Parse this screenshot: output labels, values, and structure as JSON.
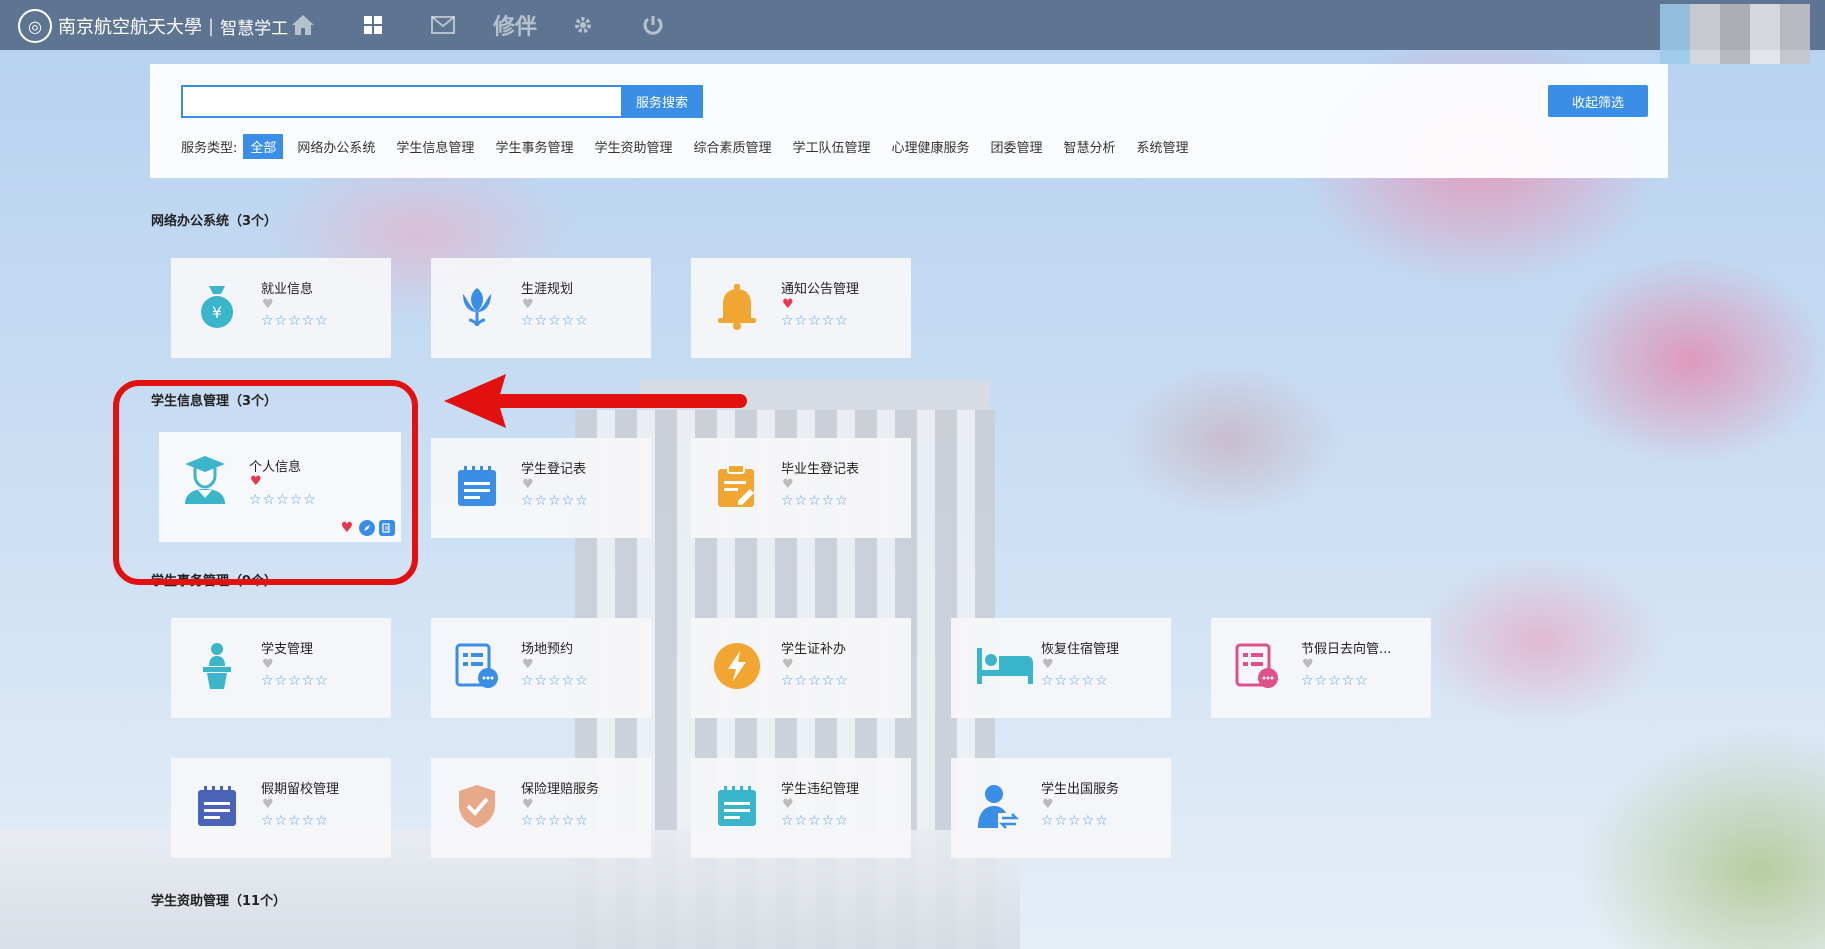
{
  "header": {
    "school_name": "南京航空航天大學",
    "separator": "|",
    "system_name": "智慧学工",
    "nav_text": "修伴",
    "seal_glyph": "◎"
  },
  "search": {
    "value": "",
    "placeholder": "",
    "button_label": "服务搜索",
    "collapse_label": "收起筛选"
  },
  "filters": {
    "label": "服务类型:",
    "chips": [
      "全部",
      "网络办公系统",
      "学生信息管理",
      "学生事务管理",
      "学生资助管理",
      "综合素质管理",
      "学工队伍管理",
      "心理健康服务",
      "团委管理",
      "智慧分析",
      "系统管理"
    ],
    "active": "全部"
  },
  "sections": {
    "office": {
      "title": "网络办公系统（3个）",
      "cards": [
        {
          "title": "就业信息",
          "favorited": false,
          "icon": "money-bag-icon",
          "color": "#3bb5c9"
        },
        {
          "title": "生涯规划",
          "favorited": false,
          "icon": "tulip-icon",
          "color": "#3a8ee6"
        },
        {
          "title": "通知公告管理",
          "favorited": true,
          "icon": "bell-icon",
          "color": "#f0a630"
        }
      ]
    },
    "info": {
      "title": "学生信息管理（3个）",
      "cards": [
        {
          "title": "个人信息",
          "favorited": true,
          "icon": "graduate-avatar-icon",
          "color": "#3bb5c9"
        },
        {
          "title": "学生登记表",
          "favorited": false,
          "icon": "calendar-list-icon",
          "color": "#3a8ee6"
        },
        {
          "title": "毕业生登记表",
          "favorited": false,
          "icon": "clipboard-edit-icon",
          "color": "#f0a630"
        }
      ]
    },
    "affairs": {
      "title": "学生事务管理（9个）",
      "cards": [
        {
          "title": "学支管理",
          "favorited": false,
          "icon": "podium-person-icon",
          "color": "#3bb5c9"
        },
        {
          "title": "场地预约",
          "favorited": false,
          "icon": "form-chat-icon",
          "color": "#3a8ee6"
        },
        {
          "title": "学生证补办",
          "favorited": false,
          "icon": "lightning-icon",
          "color": "#f0a630"
        },
        {
          "title": "恢复住宿管理",
          "favorited": false,
          "icon": "bed-icon",
          "color": "#3bb5c9"
        },
        {
          "title": "节假日去向管...",
          "favorited": false,
          "icon": "form-pink-icon",
          "color": "#e0508a"
        },
        {
          "title": "假期留校管理",
          "favorited": false,
          "icon": "calendar-dark-icon",
          "color": "#4a62b8"
        },
        {
          "title": "保险理赔服务",
          "favorited": false,
          "icon": "shield-check-icon",
          "color": "#e8a98a"
        },
        {
          "title": "学生违纪管理",
          "favorited": false,
          "icon": "calendar-cyan-icon",
          "color": "#3bb5c9"
        },
        {
          "title": "学生出国服务",
          "favorited": false,
          "icon": "person-exchange-icon",
          "color": "#3a8ee6"
        }
      ]
    },
    "aid": {
      "title": "学生资助管理（11个）"
    }
  },
  "stars": "☆☆☆☆☆",
  "heart_glyph": "♥"
}
